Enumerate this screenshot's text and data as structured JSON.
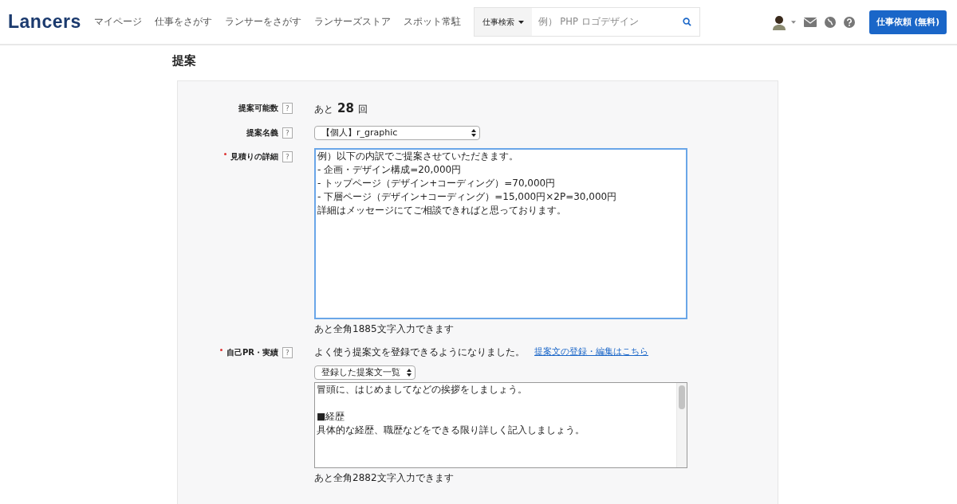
{
  "header": {
    "logo": "Lancers",
    "nav": [
      {
        "label": "マイページ"
      },
      {
        "label": "仕事をさがす"
      },
      {
        "label": "ランサーをさがす"
      },
      {
        "label": "ランサーズストア"
      },
      {
        "label": "スポット常駐"
      }
    ],
    "search": {
      "category": "仕事検索",
      "placeholder": "例） PHP ロゴデザイン"
    },
    "cta": "仕事依頼 (無料)"
  },
  "page_title": "提案",
  "form": {
    "rows": [
      {
        "kind": "count",
        "label": "提案可能数",
        "required": false,
        "help": "?",
        "prefix": "あと",
        "count": "28",
        "suffix": "回"
      },
      {
        "kind": "select",
        "label": "提案名義",
        "required": false,
        "help": "?",
        "value": "【個人】r_graphic"
      },
      {
        "kind": "textarea",
        "label": "見積りの詳細",
        "required": true,
        "help": "?",
        "focused": true,
        "lines": [
          "例）以下の内訳でご提案させていただきます。",
          "- 企画・デザイン構成=20,000円",
          "- トップページ（デザイン+コーディング）=70,000円",
          "- 下層ページ（デザイン+コーディング）=15,000円×2P=30,000円",
          "詳細はメッセージにてご相談できればと思っております。"
        ],
        "hint": "あと全角1885文字入力できます"
      },
      {
        "kind": "template",
        "label": "自己PR・実績",
        "required": true,
        "help": "?",
        "note": "よく使う提案文を登録できるようになりました。",
        "link": "提案文の登録・編集はこちら",
        "template_select": "登録した提案文一覧",
        "focused": false,
        "lines": [
          "冒頭に、はじめましてなどの挨拶をしましょう。",
          "■経歴",
          "具体的な経歴、職歴などをできる限り詳しく記入しましょう。"
        ],
        "hint": "あと全角2882文字入力できます"
      }
    ]
  }
}
